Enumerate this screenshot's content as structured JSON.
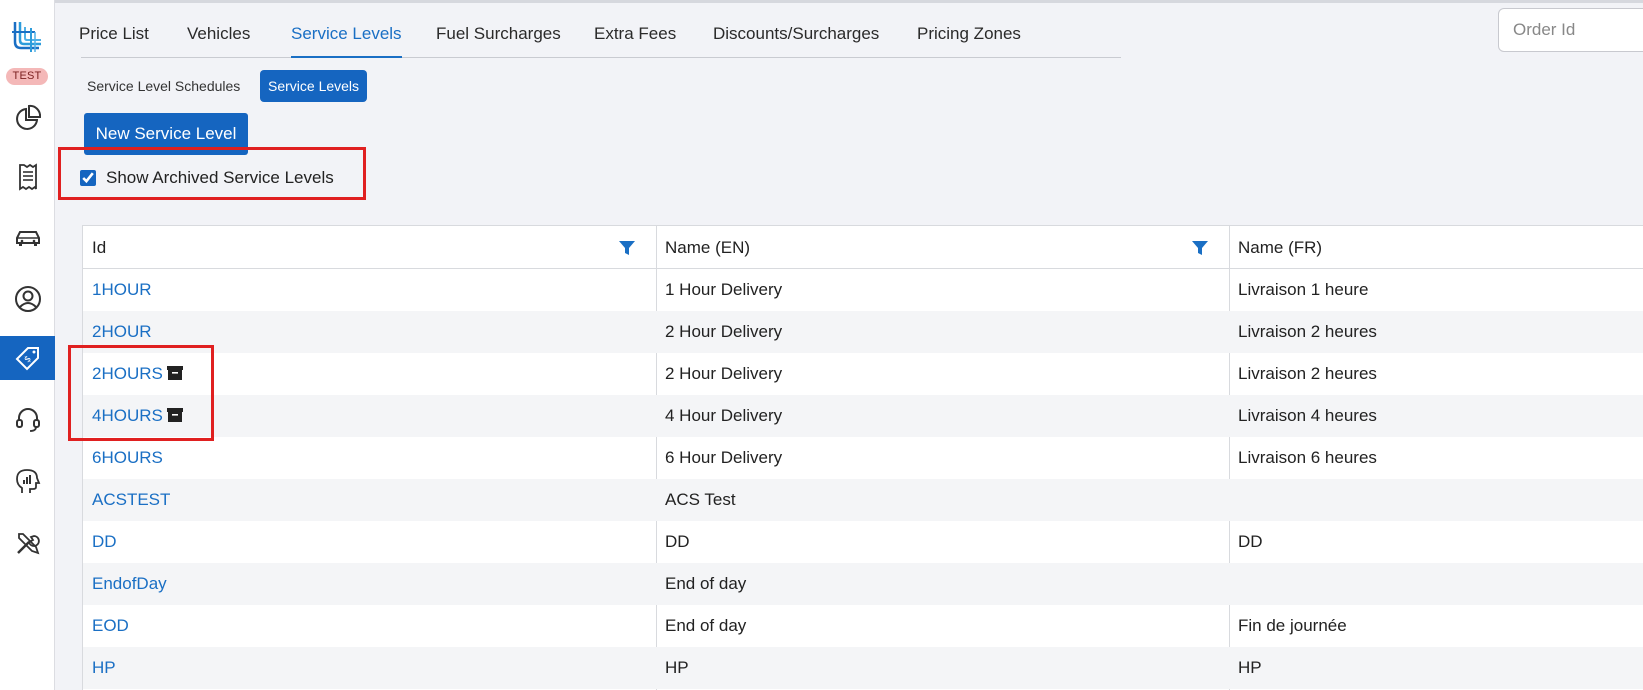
{
  "sidebar": {
    "env_badge": "TEST",
    "items": [
      {
        "icon": "pie-chart-icon",
        "active": false
      },
      {
        "icon": "receipt-icon",
        "active": false
      },
      {
        "icon": "car-icon",
        "active": false
      },
      {
        "icon": "user-circle-icon",
        "active": false
      },
      {
        "icon": "price-tag-icon",
        "active": true
      },
      {
        "icon": "headset-icon",
        "active": false
      },
      {
        "icon": "analytics-head-icon",
        "active": false
      },
      {
        "icon": "tools-icon",
        "active": false
      }
    ]
  },
  "tabs": [
    "Price List",
    "Vehicles",
    "Service Levels",
    "Fuel Surcharges",
    "Extra Fees",
    "Discounts/Surcharges",
    "Pricing Zones"
  ],
  "active_tab": "Service Levels",
  "search": {
    "placeholder": "Order Id",
    "value": ""
  },
  "subtabs": [
    "Service Level Schedules",
    "Service Levels"
  ],
  "active_subtab": "Service Levels",
  "new_button_label": "New Service Level",
  "show_archived": {
    "label": "Show Archived Service Levels",
    "checked": true
  },
  "table": {
    "columns": [
      "Id",
      "Name (EN)",
      "Name (FR)"
    ],
    "rows": [
      {
        "id": "1HOUR",
        "archived": false,
        "name_en": "1 Hour Delivery",
        "name_fr": "Livraison 1 heure"
      },
      {
        "id": "2HOUR",
        "archived": false,
        "name_en": "2 Hour Delivery",
        "name_fr": "Livraison 2 heures"
      },
      {
        "id": "2HOURS",
        "archived": true,
        "name_en": "2 Hour Delivery",
        "name_fr": "Livraison 2 heures"
      },
      {
        "id": "4HOURS",
        "archived": true,
        "name_en": "4 Hour Delivery",
        "name_fr": "Livraison 4 heures"
      },
      {
        "id": "6HOURS",
        "archived": false,
        "name_en": "6 Hour Delivery",
        "name_fr": "Livraison 6 heures"
      },
      {
        "id": "ACSTEST",
        "archived": false,
        "name_en": "ACS Test",
        "name_fr": ""
      },
      {
        "id": "DD",
        "archived": false,
        "name_en": "DD",
        "name_fr": "DD"
      },
      {
        "id": "EndofDay",
        "archived": false,
        "name_en": "End of day",
        "name_fr": ""
      },
      {
        "id": "EOD",
        "archived": false,
        "name_en": "End of day",
        "name_fr": "Fin de journée"
      },
      {
        "id": "HP",
        "archived": false,
        "name_en": "HP",
        "name_fr": "HP"
      }
    ]
  },
  "colors": {
    "accent": "#1565c0",
    "link": "#1a6fc4",
    "highlight": "#e02020",
    "badge_bg": "#f4b8b8"
  }
}
